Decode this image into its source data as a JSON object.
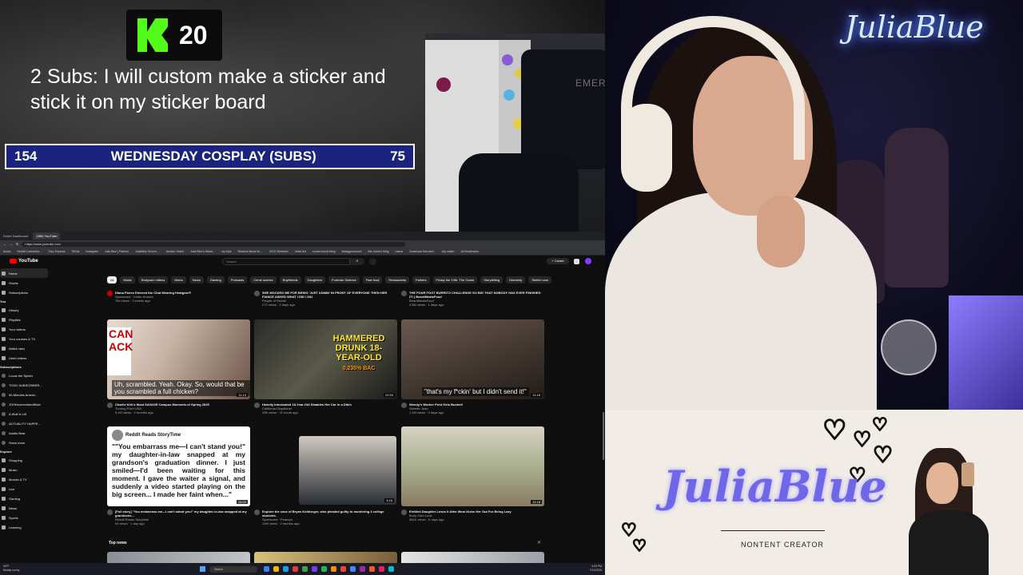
{
  "overlay": {
    "kick_count": "20",
    "goal_text": "2 Subs: I will custom make a sticker and stick it on my sticker board",
    "goal_bar": {
      "left": "154",
      "title": "WEDNESDAY COSPLAY (SUBS)",
      "right": "75"
    }
  },
  "room_cam": {
    "brand_text": "EMERGE"
  },
  "webcam": {
    "neon_sign": "JuliaBlue"
  },
  "branding": {
    "name": "JuliaBlue",
    "subtitle": "NONTENT CREATOR"
  },
  "browser": {
    "tabs": [
      {
        "label": "Kickle Dashboard"
      },
      {
        "label": "(396) YouTube"
      }
    ],
    "url": "https://www.youtube.com",
    "bookmarks": [
      "books",
      "Reddit Customiza...",
      "Tripo Express",
      "TikTok",
      "Instagram",
      "Julia Blue | Patreon",
      "JuliaBlue: Broom ...",
      "Auction Order!",
      "Julia Blue's Wardr...",
      "my clips",
      "Readout Items for ...",
      "KICK Streamer",
      "mhist bot",
      "sound sound thing",
      "twistygcomcom!",
      "this doesn't thing",
      "mama",
      "Download this label..",
      "clip maker",
      "All Bookmarks"
    ]
  },
  "youtube": {
    "logo": "YouTube",
    "search_placeholder": "Search",
    "create_label": "+ Create",
    "sidebar": {
      "main": [
        {
          "label": "Home",
          "active": true
        },
        {
          "label": "Shorts"
        },
        {
          "label": "Subscriptions"
        }
      ],
      "you_header": "You",
      "you": [
        {
          "label": "History"
        },
        {
          "label": "Playlists"
        },
        {
          "label": "Your videos"
        },
        {
          "label": "Your courses & TV"
        },
        {
          "label": "Watch later"
        },
        {
          "label": "Liked videos"
        }
      ],
      "subs_header": "Subscriptions",
      "subs": [
        {
          "label": "Lucas the Spider"
        },
        {
          "label": "TODD SUBSCRIBER..."
        },
        {
          "label": "50-Minutes Americ..."
        },
        {
          "label": "JOHNcomedianofficial"
        },
        {
          "label": "A Wolf in UK"
        },
        {
          "label": "ACTUALITY HAPPE..."
        },
        {
          "label": "Adults Bear"
        },
        {
          "label": "Show more"
        }
      ],
      "explore_header": "Explore",
      "explore": [
        {
          "label": "Shopping"
        },
        {
          "label": "Music"
        },
        {
          "label": "Movies & TV"
        },
        {
          "label": "Live"
        },
        {
          "label": "Gaming"
        },
        {
          "label": "News"
        },
        {
          "label": "Sports"
        },
        {
          "label": "Learning"
        }
      ]
    },
    "chips": [
      "All",
      "Music",
      "Bodycam videos",
      "Mixes",
      "News",
      "Gaming",
      "Podcasts",
      "Crime scenes",
      "Boyfriends",
      "Daughters",
      "Forensic Science",
      "Fast food",
      "Restaurants",
      "Fathers",
      "Friday the 13th: The Game",
      "Storytelling",
      "Dramedy",
      "Sketch com"
    ],
    "top_row": [
      {
        "title": "Diana Flores Entered the Chat Wearing Heatgear®",
        "line2": "Sponsored · Under Armour",
        "line3": "76d views · 3 weeks ago"
      },
      {
        "title": "SHE MOCKED ME FOR BEING 'JUST ADMIN' IN FRONT OF EVERYONE THEN HER FIANCE ASKED WHAT I DID I SAI",
        "line2": "People of Reddit",
        "line3": "272 views · 2 days ago"
      },
      {
        "title": "THE FOUR FOOT BURRITO CHALLENGE SO BIG THAT NOBODY HAS EVER FINISHED IT! | BeardMeatsFood",
        "line2": "BeardMeatsFood",
        "line3": "4.5M views · 1 days ago"
      }
    ],
    "videos": [
      {
        "caption": "Uh, scrambled. Yeah. Okay. So, would that be you scrambled a full chicken?",
        "duration": "11:13",
        "title": "Charlie Kirk's Most SAVAGE Campus Moments of Spring 2025",
        "channel": "Turning Point USA",
        "stats": "5.1M views · 2 months ago"
      },
      {
        "banner": "HAMMERED DRUNK 18-YEAR-OLD",
        "bac": "0.235% BAC",
        "duration": "22:53",
        "title": "Heavily Intoxicated 18-Year-Old Disables Her Car in a Ditch",
        "channel": "California Dispatcher",
        "stats": "29K views · 11 hours ago"
      },
      {
        "caption": "\"that's my f*ckin' but I didn't send it!\"",
        "duration": "11:18",
        "title": "Wendy's Worker Pred Gets Busted!",
        "channel": "Skeeter Jean",
        "stats": "1.1M views · 9 days ago"
      },
      {
        "author": "Reddit Reads StoryTime",
        "story": "\"\"You embarrass me—I can't stand you!\" my daughter-in-law snapped at my grandson's graduation dinner. I just smiled—I'd been waiting for this moment. I gave the waiter a signal, and suddenly a video started playing on the big screen... I made her faint when...\"",
        "duration": "28:00",
        "title": "[Full story] \"You embarrass me—I can't stand you!\" my daughter-in-law snapped at my grandsons...",
        "channel": "Reddit Reads Storytime",
        "stats": "94 views · 1 day ago"
      },
      {
        "duration": "3:16",
        "title": "Explore the case of Bryan Kohberger, who pleaded guilty to murdering 4 college students.",
        "channel": "Sponsored · Peacock",
        "stats": "10M views · 2 months ago"
      },
      {
        "duration": "11:18",
        "title": "Entitled Daughter Loses It After Mom Kicks Her Out For Being Lazy",
        "channel": "Body Cam Look",
        "stats": "381K views · 6 days ago"
      }
    ],
    "top_news": "Top news"
  },
  "taskbar": {
    "weather": "90°F\nMostly sunny",
    "search": "Search",
    "time": "4:03 PM",
    "date": "7/21/2025"
  }
}
